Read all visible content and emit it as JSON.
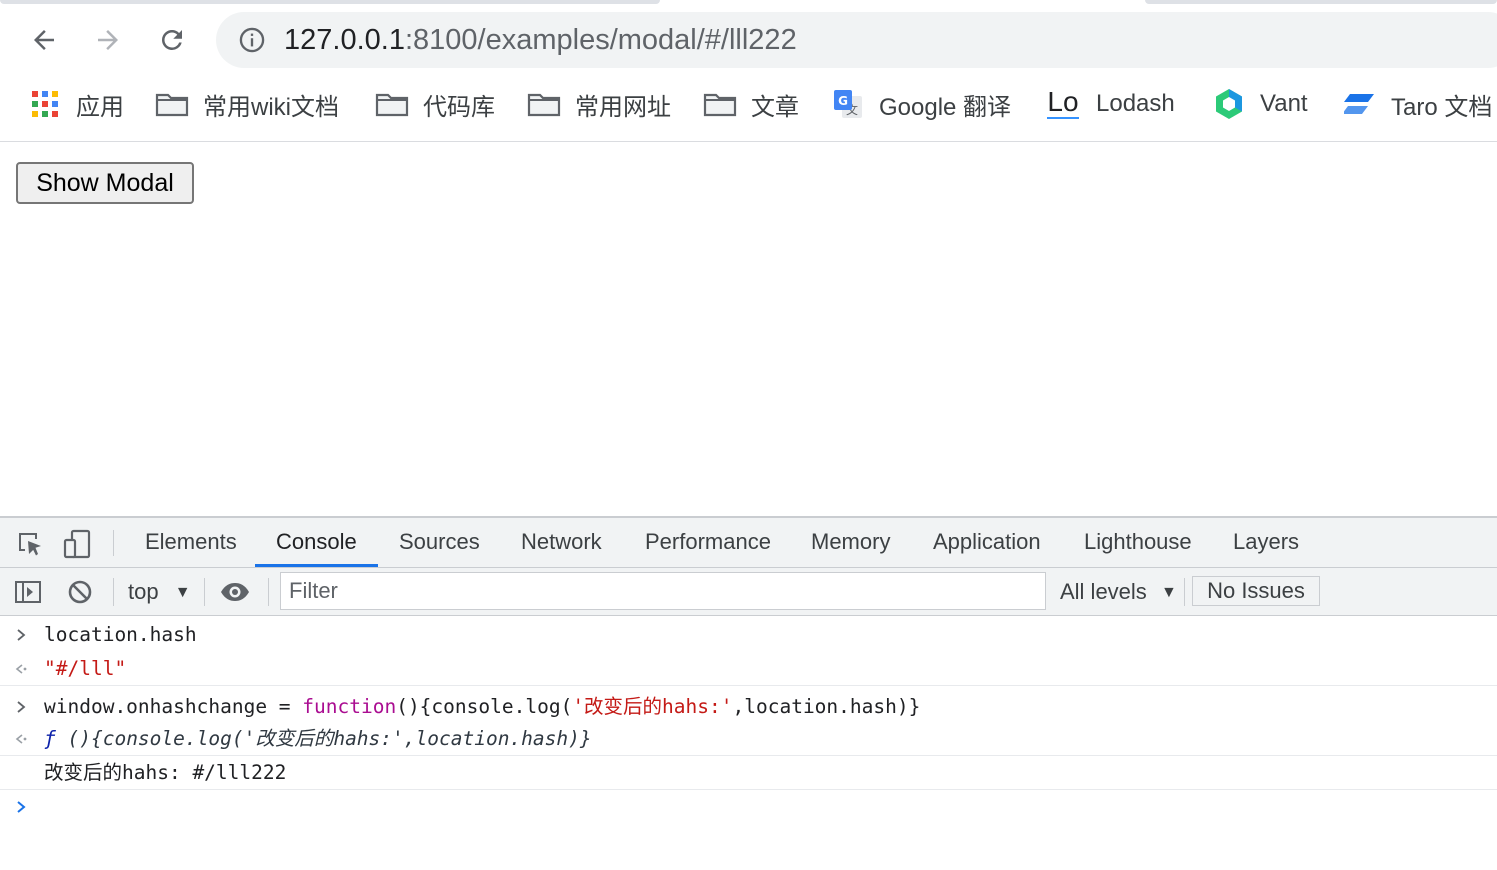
{
  "browser": {
    "url_host": "127.0.0.1",
    "url_path": ":8100/examples/modal/#/lll222"
  },
  "bookmarks": [
    {
      "label": "应用",
      "icon": "apps-grid-icon"
    },
    {
      "label": "常用wiki文档",
      "icon": "folder-icon"
    },
    {
      "label": "代码库",
      "icon": "folder-icon"
    },
    {
      "label": "常用网址",
      "icon": "folder-icon"
    },
    {
      "label": "文章",
      "icon": "folder-icon"
    },
    {
      "label": "Google 翻译",
      "icon": "google-translate-icon"
    },
    {
      "label": "Lodash",
      "icon": "lodash-logo-icon",
      "logo_text": "Lo"
    },
    {
      "label": "Vant",
      "icon": "vant-logo-icon"
    },
    {
      "label": "Taro 文档",
      "icon": "taro-logo-icon"
    }
  ],
  "page": {
    "button_label": "Show Modal"
  },
  "devtools": {
    "tabs": [
      "Elements",
      "Console",
      "Sources",
      "Network",
      "Performance",
      "Memory",
      "Application",
      "Lighthouse",
      "Layers"
    ],
    "active_tab": "Console",
    "context": "top",
    "filter_placeholder": "Filter",
    "levels": "All levels",
    "issues": "No Issues",
    "accent": "#1a73e8"
  },
  "console": {
    "input1": "location.hash",
    "result1": "\"#/lll\"",
    "input2_prefix": "window.onhashchange = ",
    "input2_keyword": "function",
    "input2_mid": "(){console.log(",
    "input2_string": "'改变后的hahs:'",
    "input2_suffix": ",location.hash)}",
    "result2_f": "ƒ",
    "result2_body": " (){console.log('改变后的hahs:',location.hash)}",
    "log1": "改变后的hahs: #/lll222"
  }
}
